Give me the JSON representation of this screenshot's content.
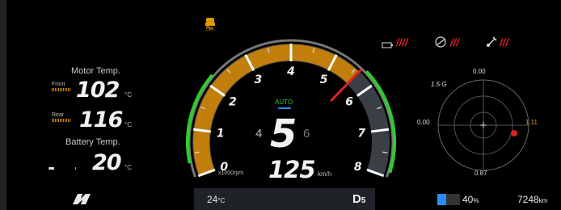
{
  "left_panel": {
    "motor_temp_label": "Motor Temp.",
    "front_label": "Front",
    "front_value": "102",
    "rear_label": "Rear",
    "rear_value": "116",
    "battery_temp_label": "Battery Temp.",
    "battery_value": "20",
    "unit_c": "°C"
  },
  "gauge": {
    "ticks": [
      "0",
      "1",
      "2",
      "3",
      "4",
      "5",
      "6",
      "7",
      "8"
    ],
    "rpm_unit": "x1000rpm",
    "mode": "AUTO",
    "prev_gear": "4",
    "gear": "5",
    "next_gear": "6",
    "speed": "125",
    "speed_unit": "km/h",
    "needle_value_krpm": 5.6
  },
  "g_meter": {
    "top": "0.00",
    "max": "1.5 G",
    "left": "0.00",
    "right": "1.11",
    "bottom": "0.87"
  },
  "status_bar": {
    "temperature": "24",
    "temperature_unit": "°C",
    "drive_mode": "D",
    "drive_sub": "5",
    "battery_percent": "40",
    "battery_unit": "%",
    "battery_level": 0.4,
    "odometer": "7248",
    "odometer_unit": "km"
  },
  "warnings": {
    "stripes": "////",
    "stripes2": "///",
    "stripes3": "///",
    "esc_off_text": "OFF"
  },
  "colors": {
    "accent_orange": "#d98a00",
    "needle_red": "#e02020",
    "green": "#2ecc2e",
    "warning_red": "#e0202a",
    "blue": "#2a8cff"
  }
}
